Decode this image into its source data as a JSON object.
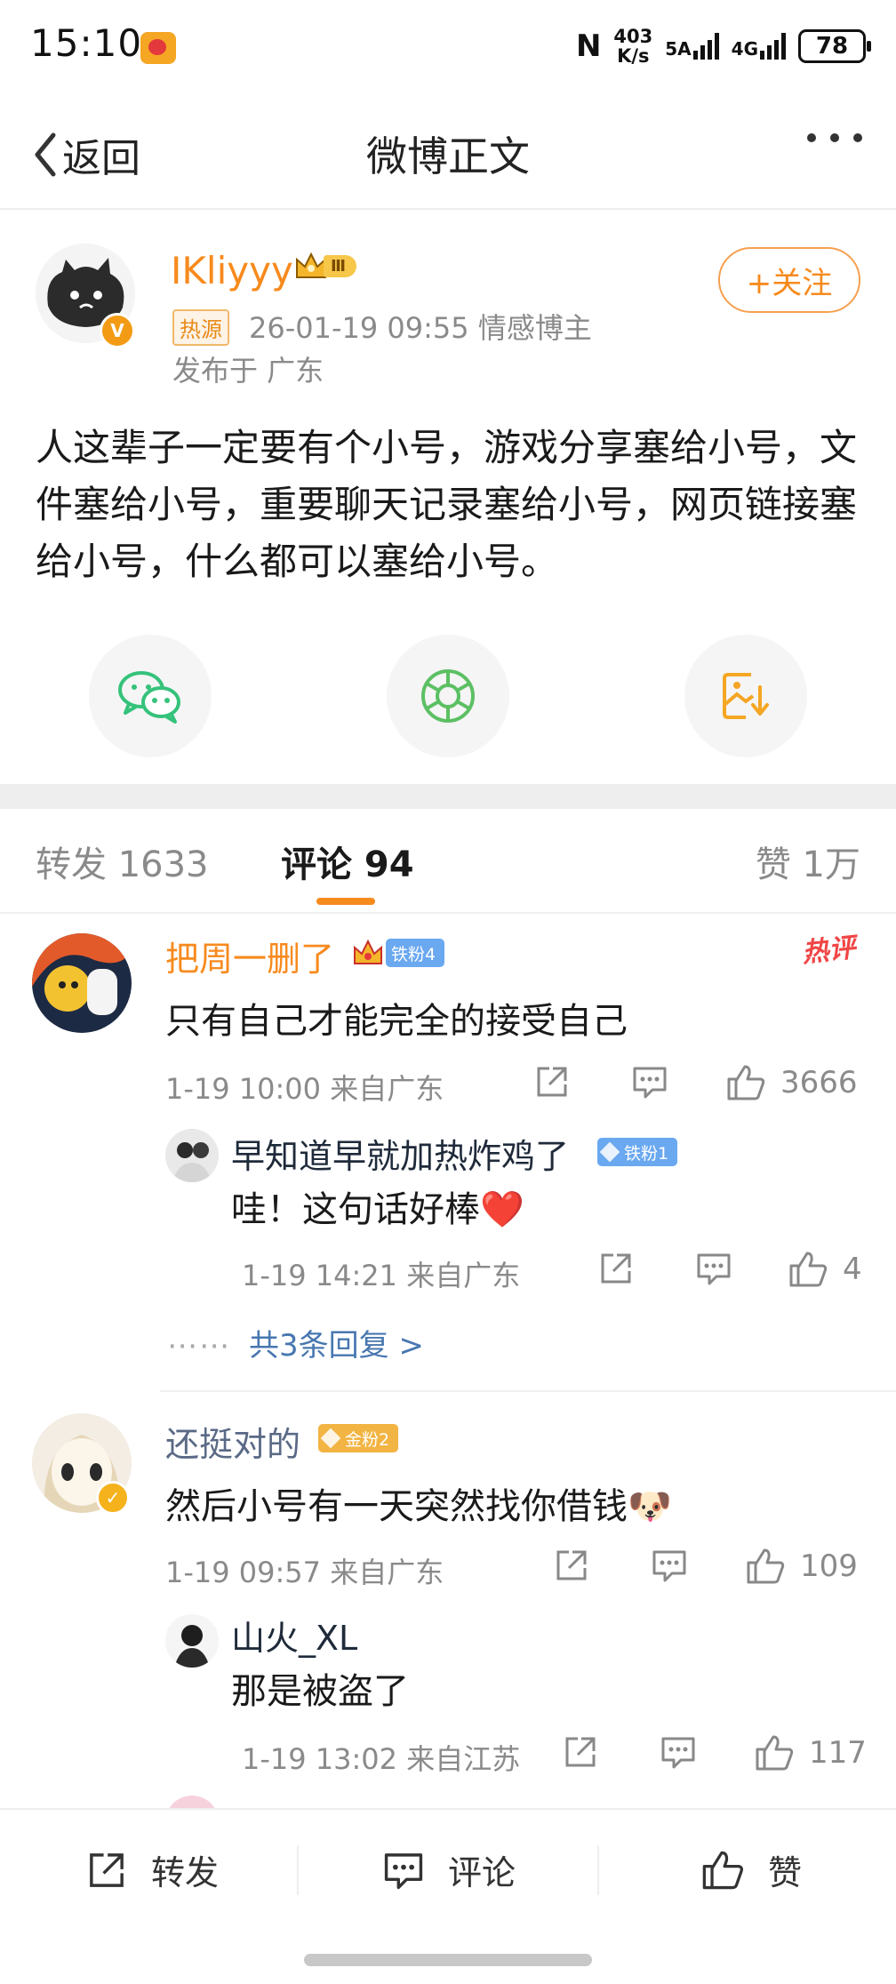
{
  "status_bar": {
    "time": "15:10",
    "speed_top": "403",
    "speed_bottom": "K/s",
    "network_1": "5A",
    "network_2": "4G",
    "battery": "78"
  },
  "nav": {
    "back_label": "返回",
    "title": "微博正文"
  },
  "post": {
    "author": "IKliyyy",
    "crown_level": "Ⅲ",
    "follow_label": "+关注",
    "source_tag": "热源",
    "meta": "26-01-19 09:55  情感博主",
    "location": "发布于 广东",
    "text": "人这辈子一定要有个小号，游戏分享塞给小号，文件塞给小号，重要聊天记录塞给小号，网页链接塞给小号，什么都可以塞给小号。"
  },
  "tabs": {
    "repost": "转发 1633",
    "comment": "评论 94",
    "like": "赞 1万"
  },
  "comments": [
    {
      "name": "把周一删了",
      "badge": "铁粉4",
      "hot_label": "热评",
      "text": "只有自己才能完全的接受自己",
      "time": "1-19 10:00 来自广东",
      "likes": "3666",
      "reply": {
        "name": "早知道早就加热炸鸡了",
        "badge": "铁粉1",
        "text": "哇！这句话好棒❤️",
        "time": "1-19 14:21 来自广东",
        "likes": "4"
      },
      "more_replies": "共3条回复 >"
    },
    {
      "name": "还挺对的",
      "badge": "金粉2",
      "text": "然后小号有一天突然找你借钱🐶",
      "time": "1-19 09:57 来自广东",
      "likes": "109",
      "reply": {
        "name": "山火_XL",
        "text": "那是被盗了",
        "time": "1-19 13:02 来自江苏",
        "likes": "117"
      }
    }
  ],
  "bottom_bar": {
    "repost": "转发",
    "comment": "评论",
    "like": "赞"
  },
  "colors": {
    "accent": "#f78a1d",
    "link": "#4877b0",
    "iron_badge": "#6aa8f0",
    "gold_badge": "#f2b443"
  },
  "icons": [
    "back-chevron-icon",
    "more-dots-icon",
    "wechat-icon",
    "moments-icon",
    "save-image-icon",
    "repost-icon",
    "comment-icon",
    "like-icon"
  ]
}
